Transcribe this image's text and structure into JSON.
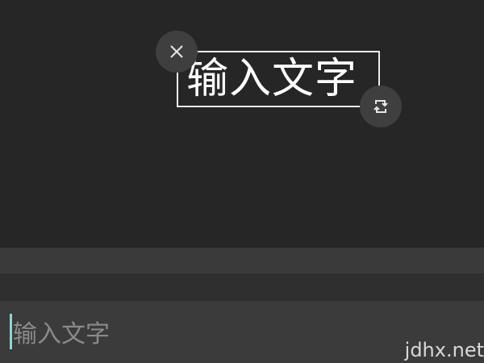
{
  "canvas": {
    "sticker_text": "输入文字",
    "close_icon": "close-icon",
    "rotate_icon": "rotate-scale-icon"
  },
  "input": {
    "placeholder": "输入文字"
  },
  "watermark": "jdhx.net"
}
